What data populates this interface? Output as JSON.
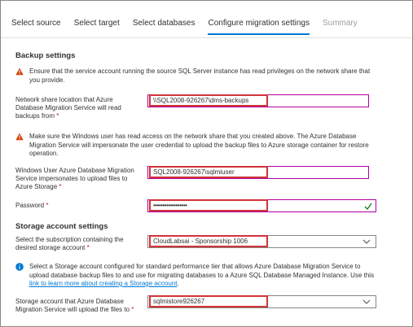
{
  "tabs": [
    {
      "label": "Select source"
    },
    {
      "label": "Select target"
    },
    {
      "label": "Select databases"
    },
    {
      "label": "Configure migration settings"
    },
    {
      "label": "Summary"
    }
  ],
  "backup": {
    "heading": "Backup settings",
    "note": "Ensure that the service account running the source SQL Server instance has read privileges on the network share that you provide.",
    "share_label": "Network share location that Azure Database Migration Service will read backups from",
    "share_value": "\\\\SQL2008-926267\\dms-backups",
    "user_note": "Make sure the Windows user has read access on the network share that you created above. The Azure Database Migration Service will impersonate the user credential to upload the backup files to Azure storage container for restore operation.",
    "user_label": "Windows User Azure Database Migration Service impersonates to upload files to Azure Storage",
    "user_value": "SQL2008-926267\\sqlmiuser",
    "password_label": "Password",
    "password_value": "••••••••••••••••••"
  },
  "storage": {
    "heading": "Storage account settings",
    "subscription_label": "Select the subscription containing the desired storage account",
    "subscription_value": "CloudLabsai - Sponsorship 1006",
    "info_note": "Select a Storage account configured for standard performance tier that allows Azure Database Migration Service to upload database backup files to and use for migrating databases to a Azure SQL Database Managed Instance. Use this",
    "info_link": "link to learn more about creating a Storage account",
    "account_label": "Storage account that Azure Database Migration Service will upload the files to",
    "account_value": "sqlmistore926267"
  },
  "required_mark": "*",
  "colors": {
    "accent": "#0078d4",
    "highlight": "#d13438",
    "warning": "#d83b01",
    "valid": "#107c10"
  }
}
